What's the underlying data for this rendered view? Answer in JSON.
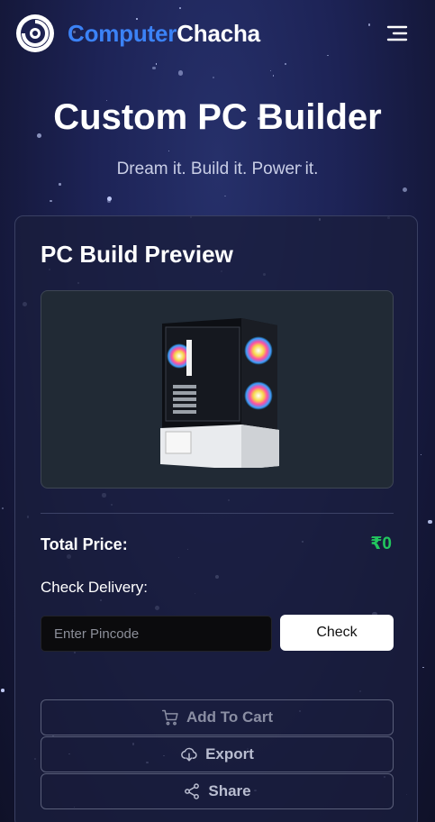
{
  "header": {
    "brand_part1": "Computer",
    "brand_part2": "Chacha",
    "logo_icon": "power-ring-logo",
    "menu_icon": "hamburger-icon"
  },
  "hero": {
    "title": "Custom PC Builder",
    "subtitle": "Dream it. Build it. Power it."
  },
  "build_card": {
    "title": "PC Build Preview",
    "preview_image": "pc-case-image",
    "total_label": "Total Price:",
    "total_value": "₹0",
    "delivery_label": "Check Delivery:",
    "pincode_placeholder": "Enter Pincode",
    "pincode_value": "",
    "check_label": "Check",
    "actions": {
      "add_to_cart": "Add To Cart",
      "export": "Export",
      "share": "Share"
    }
  },
  "colors": {
    "brand_blue": "#3b82f6",
    "price_green": "#22c55e",
    "background": "#1d2356"
  }
}
